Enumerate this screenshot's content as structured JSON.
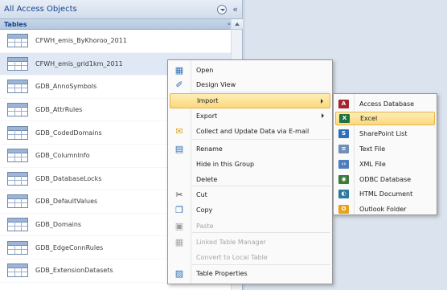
{
  "nav": {
    "title": "All Access Objects",
    "group_title": "Tables",
    "group_chevron": "»",
    "collapse_glyph": "«",
    "items": [
      {
        "label": "CFWH_emis_ByKhoroo_2011"
      },
      {
        "label": "CFWH_emis_grid1km_2011"
      },
      {
        "label": "GDB_AnnoSymbols"
      },
      {
        "label": "GDB_AttrRules"
      },
      {
        "label": "GDB_CodedDomains"
      },
      {
        "label": "GDB_ColumnInfo"
      },
      {
        "label": "GDB_DatabaseLocks"
      },
      {
        "label": "GDB_DefaultValues"
      },
      {
        "label": "GDB_Domains"
      },
      {
        "label": "GDB_EdgeConnRules"
      },
      {
        "label": "GDB_ExtensionDatasets"
      }
    ]
  },
  "context_menu": {
    "items": [
      {
        "label": "Open",
        "icon": "open-icon",
        "glyph": "▦",
        "color": "#2e6db5"
      },
      {
        "label": "Design View",
        "icon": "design-view-icon",
        "glyph": "✐",
        "color": "#2e6db5"
      },
      {
        "label": "Import",
        "icon": "",
        "glyph": "",
        "color": "#000000"
      },
      {
        "label": "Export",
        "icon": "",
        "glyph": "",
        "color": "#000000"
      },
      {
        "label": "Collect and Update Data via E-mail",
        "icon": "email-collect-icon",
        "glyph": "✉",
        "color": "#d9a320"
      },
      {
        "label": "Rename",
        "icon": "rename-icon",
        "glyph": "▤",
        "color": "#2e6db5"
      },
      {
        "label": "Hide in this Group",
        "icon": "",
        "glyph": "",
        "color": "#000000"
      },
      {
        "label": "Delete",
        "icon": "",
        "glyph": "",
        "color": "#000000"
      },
      {
        "label": "Cut",
        "icon": "scissors-icon",
        "glyph": "✂",
        "color": "#3b3b3b"
      },
      {
        "label": "Copy",
        "icon": "copy-icon",
        "glyph": "❐",
        "color": "#2e6db5"
      },
      {
        "label": "Paste",
        "icon": "paste-icon",
        "glyph": "▣",
        "color": "#9c9c9c"
      },
      {
        "label": "Linked Table Manager",
        "icon": "linked-table-manager-icon",
        "glyph": "▦",
        "color": "#a7a7a7"
      },
      {
        "label": "Convert to Local Table",
        "icon": "",
        "glyph": "",
        "color": "#000000"
      },
      {
        "label": "Table Properties",
        "icon": "table-properties-icon",
        "glyph": "▨",
        "color": "#2e6db5"
      }
    ]
  },
  "import_submenu": {
    "items": [
      {
        "label": "Access Database",
        "icon": "access-database-icon",
        "glyph": "A",
        "color": "#a4262c"
      },
      {
        "label": "Excel",
        "icon": "excel-icon",
        "glyph": "X",
        "color": "#1f7244"
      },
      {
        "label": "SharePoint List",
        "icon": "sharepoint-list-icon",
        "glyph": "S",
        "color": "#2f6fb5"
      },
      {
        "label": "Text File",
        "icon": "text-file-icon",
        "glyph": "≡",
        "color": "#6f8fb8"
      },
      {
        "label": "XML File",
        "icon": "xml-file-icon",
        "glyph": "‹›",
        "color": "#4d7fbf"
      },
      {
        "label": "ODBC Database",
        "icon": "odbc-database-icon",
        "glyph": "◉",
        "color": "#3d7b3d"
      },
      {
        "label": "HTML Document",
        "icon": "html-document-icon",
        "glyph": "◐",
        "color": "#2c7a9e"
      },
      {
        "label": "Outlook Folder",
        "icon": "outlook-folder-icon",
        "glyph": "O",
        "color": "#e8a21a"
      }
    ]
  }
}
